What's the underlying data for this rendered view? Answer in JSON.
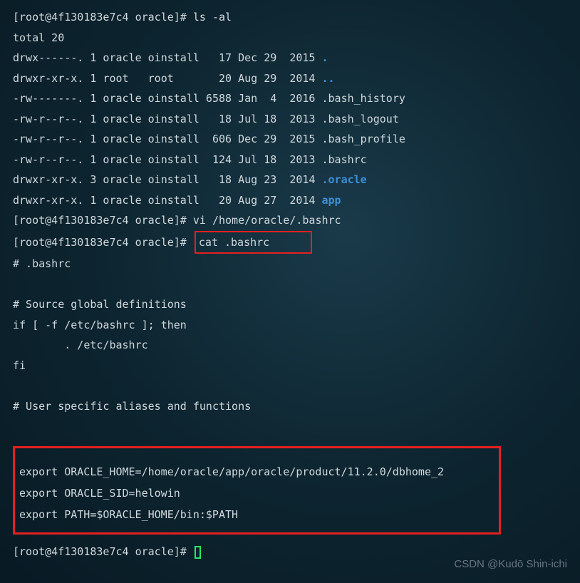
{
  "prompt": "[root@4f130183e7c4 oracle]#",
  "commands": {
    "ls": "ls -al",
    "vi": "vi /home/oracle/.bashrc",
    "cat": "cat .bashrc"
  },
  "ls_output": {
    "total": "total 20",
    "rows": [
      {
        "perms": "drwx------.",
        "links": "1",
        "owner": "oracle",
        "group": "oinstall",
        "size": "  17",
        "date": "Dec 29  2015",
        "name": ".",
        "blue": true
      },
      {
        "perms": "drwxr-xr-x.",
        "links": "1",
        "owner": "root  ",
        "group": "root    ",
        "size": "  20",
        "date": "Aug 29  2014",
        "name": "..",
        "blue": true
      },
      {
        "perms": "-rw-------.",
        "links": "1",
        "owner": "oracle",
        "group": "oinstall",
        "size": "6588",
        "date": "Jan  4  2016",
        "name": ".bash_history",
        "blue": false
      },
      {
        "perms": "-rw-r--r--.",
        "links": "1",
        "owner": "oracle",
        "group": "oinstall",
        "size": "  18",
        "date": "Jul 18  2013",
        "name": ".bash_logout",
        "blue": false
      },
      {
        "perms": "-rw-r--r--.",
        "links": "1",
        "owner": "oracle",
        "group": "oinstall",
        "size": " 606",
        "date": "Dec 29  2015",
        "name": ".bash_profile",
        "blue": false
      },
      {
        "perms": "-rw-r--r--.",
        "links": "1",
        "owner": "oracle",
        "group": "oinstall",
        "size": " 124",
        "date": "Jul 18  2013",
        "name": ".bashrc",
        "blue": false
      },
      {
        "perms": "drwxr-xr-x.",
        "links": "3",
        "owner": "oracle",
        "group": "oinstall",
        "size": "  18",
        "date": "Aug 23  2014",
        "name": ".oracle",
        "blue": true
      },
      {
        "perms": "drwxr-xr-x.",
        "links": "1",
        "owner": "oracle",
        "group": "oinstall",
        "size": "  20",
        "date": "Aug 27  2014",
        "name": "app",
        "blue": true
      }
    ]
  },
  "bashrc": {
    "l1": "# .bashrc",
    "l2": "# Source global definitions",
    "l3": "if [ -f /etc/bashrc ]; then",
    "l4": "        . /etc/bashrc",
    "l5": "fi",
    "l6": "# User specific aliases and functions"
  },
  "exports": {
    "e1": "export ORACLE_HOME=/home/oracle/app/oracle/product/11.2.0/dbhome_2",
    "e2": "export ORACLE_SID=helowin",
    "e3": "export PATH=$ORACLE_HOME/bin:$PATH"
  },
  "watermark": "CSDN @Kudō Shin-ichi"
}
